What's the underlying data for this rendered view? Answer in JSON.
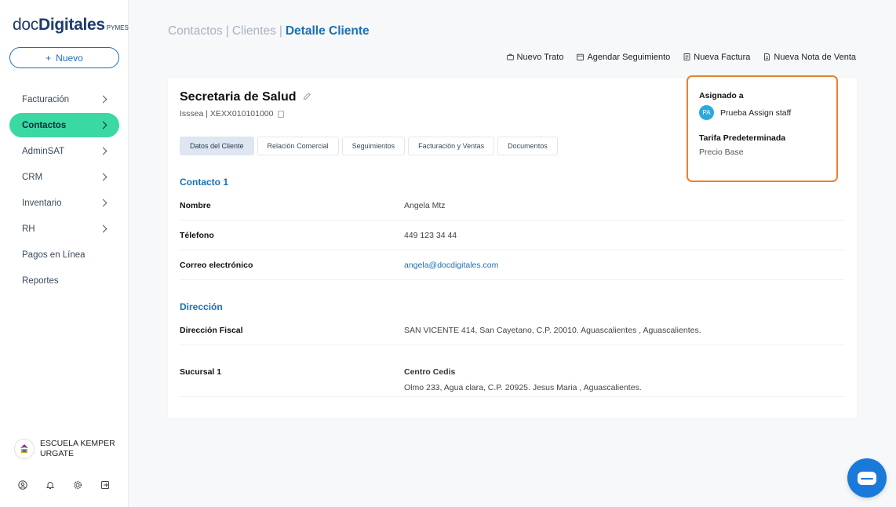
{
  "brand": {
    "part1": "doc",
    "part2": "Digitales",
    "suffix": "PYMES"
  },
  "sidebar": {
    "new_button": {
      "icon": "+",
      "label": "Nuevo"
    },
    "items": [
      {
        "label": "Facturación",
        "has_chevron": true
      },
      {
        "label": "Contactos",
        "has_chevron": true,
        "active": true
      },
      {
        "label": "AdminSAT",
        "has_chevron": true
      },
      {
        "label": "CRM",
        "has_chevron": true
      },
      {
        "label": "Inventario",
        "has_chevron": true
      },
      {
        "label": "RH",
        "has_chevron": true
      },
      {
        "label": "Pagos en Línea",
        "has_chevron": false
      },
      {
        "label": "Reportes",
        "has_chevron": false
      }
    ],
    "company": {
      "name": "ESCUELA KEMPER URGATE"
    },
    "bottom_icons": [
      "user-icon",
      "bell-icon",
      "gear-icon",
      "logout-icon"
    ]
  },
  "breadcrumb": {
    "part1": "Contactos",
    "part2": "Clientes",
    "current": "Detalle Cliente",
    "separator": "|"
  },
  "actions": [
    {
      "label": "Nuevo Trato",
      "icon": "briefcase-icon"
    },
    {
      "label": "Agendar Seguimiento",
      "icon": "calendar-icon"
    },
    {
      "label": "Nueva Factura",
      "icon": "invoice-icon"
    },
    {
      "label": "Nueva Nota de Venta",
      "icon": "receipt-icon"
    }
  ],
  "client": {
    "name": "Secretaria de Salud",
    "subtitle": "Isssea | XEXX010101000"
  },
  "tabs": [
    {
      "label": "Datos del Cliente",
      "active": true
    },
    {
      "label": "Relación Comercial"
    },
    {
      "label": "Seguimientos"
    },
    {
      "label": "Facturación y Ventas"
    },
    {
      "label": "Documentos"
    }
  ],
  "contact": {
    "title": "Contacto 1",
    "rows": [
      {
        "label": "Nombre",
        "value": "Angela Mtz"
      },
      {
        "label": "Télefono",
        "value": "449 123 34 44"
      },
      {
        "label": "Correo electrónico",
        "value": "angela@docdigitales.com"
      }
    ]
  },
  "address": {
    "title": "Dirección",
    "fiscal_label": "Dirección Fiscal",
    "fiscal_value": "SAN VICENTE 414, San Cayetano, C.P. 20010. Aguascalientes , Aguascalientes.",
    "branch_label": "Sucursal 1",
    "branch_name": "Centro Cedis",
    "branch_address": "Olmo 233, Agua clara, C.P. 20925. Jesus Maria , Aguascalientes."
  },
  "assigned": {
    "title": "Asignado a",
    "initials": "PA",
    "staff_name": "Prueba Assign staff",
    "tarifa_title": "Tarifa Predeterminada",
    "tarifa_value": "Precio Base"
  },
  "colors": {
    "accent": "#1a6fb5",
    "active_nav": "#3ad9a4",
    "highlight_border": "#e8822c",
    "chat": "#1a7ad9"
  }
}
